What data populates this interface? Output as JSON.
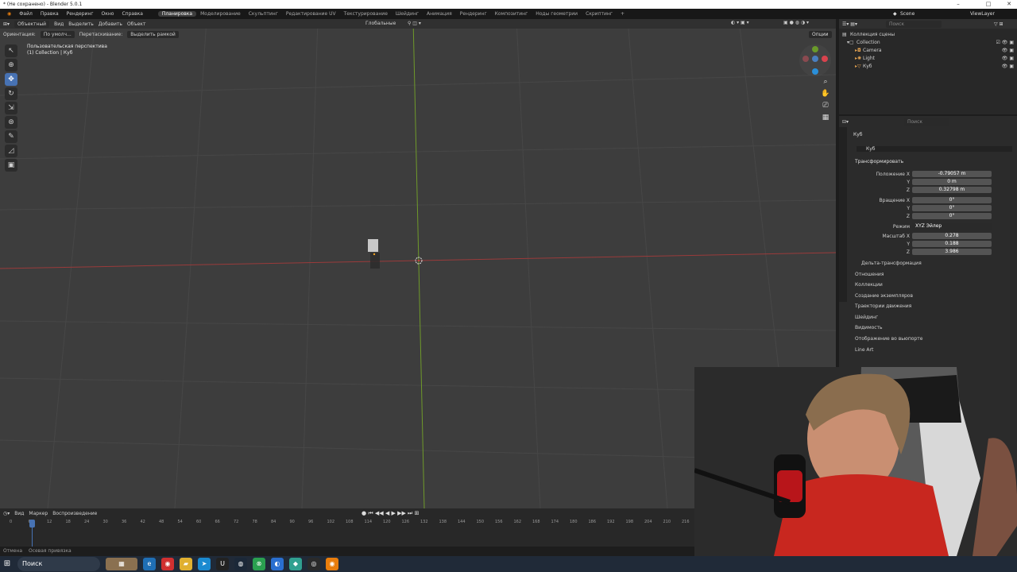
{
  "window": {
    "title": "* (Не сохранено) - Blender 5.0.1"
  },
  "menu": {
    "items": [
      "Файл",
      "Правка",
      "Рендеринг",
      "Окно",
      "Справка"
    ],
    "workspaces": [
      "Планировка",
      "Моделирование",
      "Скульптинг",
      "Редактирование UV",
      "Текстурирование",
      "Шейдинг",
      "Анимация",
      "Рендеринг",
      "Композитинг",
      "Ноды геометрии",
      "Скриптинг"
    ],
    "active_workspace": "Планировка",
    "add_workspace": "+",
    "scene": "Scene",
    "view_layer": "ViewLayer"
  },
  "viewport_header": {
    "mode": "Объектный",
    "view": "Вид",
    "select": "Выделить",
    "add": "Добавить",
    "object": "Объект",
    "orientation_label": "Ориентация:",
    "orientation_value": "По умолч...",
    "drag_label": "Перетаскивание:",
    "drag_value": "Выделить рамкой",
    "transform_space": "Глобальные",
    "options": "Опции"
  },
  "viewport": {
    "perspective": "Пользовательская перспектива",
    "collection_path": "(1) Collection | Куб"
  },
  "outliner": {
    "search_placeholder": "Поиск",
    "root": "Коллекция сцены",
    "collection": "Collection",
    "items": [
      "Camera",
      "Light",
      "Куб"
    ]
  },
  "properties": {
    "search_placeholder": "Поиск",
    "object_name": "Куб",
    "object_datablock": "Куб",
    "transform_title": "Трансформировать",
    "location_label": "Положение X",
    "location": [
      "-0.79057 m",
      "0 m",
      "0.32798 m"
    ],
    "rotation_label": "Вращение X",
    "rotation": [
      "0°",
      "0°",
      "0°"
    ],
    "mode_label": "Режим",
    "mode_value": "XYZ Эйлер",
    "scale_label": "Масштаб X",
    "scale": [
      "0.278",
      "0.188",
      "3.986"
    ],
    "axis_y": "Y",
    "axis_z": "Z",
    "panels": [
      "Дельта-трансформация",
      "Отношения",
      "Коллекции",
      "Создание экземпляров",
      "Траектории движения",
      "Шейдинг",
      "Видимость",
      "Отображение во вьюпорте",
      "Line Art"
    ]
  },
  "timeline": {
    "view": "Вид",
    "marker": "Маркер",
    "playback": "Воспроизведение",
    "current_frame": "1",
    "ticks": [
      "0",
      "6",
      "12",
      "18",
      "24",
      "30",
      "36",
      "42",
      "48",
      "54",
      "60",
      "66",
      "72",
      "78",
      "84",
      "90",
      "96",
      "102",
      "108",
      "114",
      "120",
      "126",
      "132",
      "138",
      "144",
      "150",
      "156",
      "162",
      "168",
      "174",
      "180",
      "186",
      "192",
      "198",
      "204",
      "210",
      "216",
      "222",
      "228"
    ]
  },
  "statusbar": {
    "undo": "Отмена",
    "snap": "Осевая привязка"
  },
  "taskbar": {
    "search": "Поиск"
  }
}
